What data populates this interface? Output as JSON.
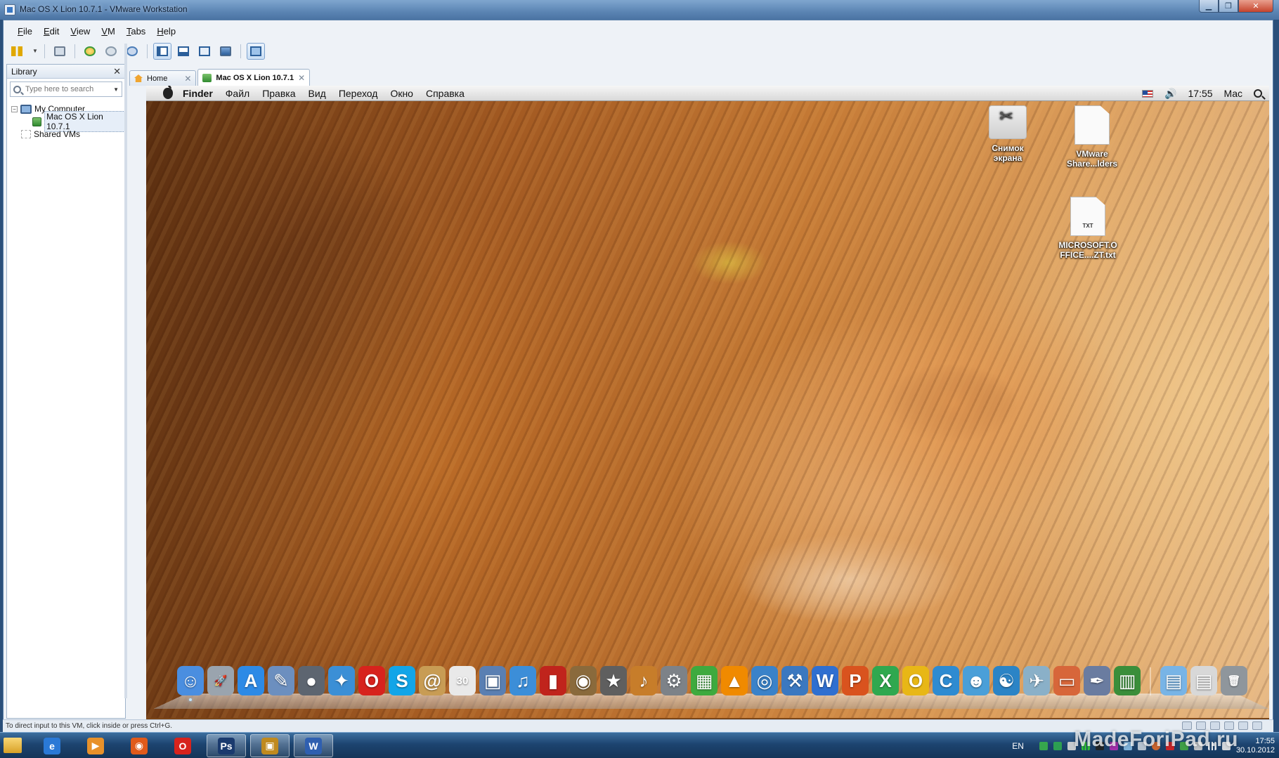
{
  "window": {
    "title": "Mac OS X Lion 10.7.1 - VMware Workstation",
    "controls": {
      "minimize": "▁",
      "maximize": "❐",
      "close": "✕"
    }
  },
  "menu": [
    "File",
    "Edit",
    "View",
    "VM",
    "Tabs",
    "Help"
  ],
  "library": {
    "title": "Library",
    "close": "✕",
    "search_placeholder": "Type here to search",
    "tree": {
      "my_computer": "My Computer",
      "vm": "Mac OS X Lion 10.7.1",
      "shared": "Shared VMs"
    }
  },
  "tabs": [
    {
      "label": "Home",
      "close": "✕"
    },
    {
      "label": "Mac OS X Lion 10.7.1",
      "close": "✕"
    }
  ],
  "mac": {
    "app": "Finder",
    "menus": [
      "Файл",
      "Правка",
      "Вид",
      "Переход",
      "Окно",
      "Справка"
    ],
    "time": "17:55",
    "user": "Mac",
    "speaker": "🔊"
  },
  "desktop_icons": [
    {
      "line1": "Снимок",
      "line2": "экрана"
    },
    {
      "line1": "VMware",
      "line2": "Share...lders"
    },
    {
      "line1": "MICROSOFT.O",
      "line2": "FFICE....ZT.txt",
      "tag": "TXT"
    }
  ],
  "dock": [
    {
      "name": "finder",
      "glyph": "☺",
      "color": "#4a8ee0"
    },
    {
      "name": "launchpad",
      "glyph": "🚀",
      "color": "#9aa4ae"
    },
    {
      "name": "app-store",
      "glyph": "A",
      "color": "#2d8ae6"
    },
    {
      "name": "preview",
      "glyph": "✎",
      "color": "#6c8fbf"
    },
    {
      "name": "facetime",
      "glyph": "●",
      "color": "#5d6570"
    },
    {
      "name": "safari",
      "glyph": "✦",
      "color": "#3b8fd6"
    },
    {
      "name": "opera",
      "glyph": "O",
      "color": "#d7231d"
    },
    {
      "name": "skype",
      "glyph": "S",
      "color": "#12a5e8"
    },
    {
      "name": "address-book",
      "glyph": "@",
      "color": "#c89c54"
    },
    {
      "name": "ical",
      "glyph": "30",
      "color": "#e9e9e9"
    },
    {
      "name": "iphoto",
      "glyph": "▣",
      "color": "#5a7fb2"
    },
    {
      "name": "itunes",
      "glyph": "♫",
      "color": "#3c8ed8"
    },
    {
      "name": "photo-booth",
      "glyph": "▮",
      "color": "#c0241c"
    },
    {
      "name": "image-capture",
      "glyph": "◉",
      "color": "#8a6a3c"
    },
    {
      "name": "imovie",
      "glyph": "★",
      "color": "#5f5f5f"
    },
    {
      "name": "garageband",
      "glyph": "♪",
      "color": "#c77d2a"
    },
    {
      "name": "system-preferences",
      "glyph": "⚙",
      "color": "#7d8288"
    },
    {
      "name": "numbers",
      "glyph": "▦",
      "color": "#3eaa3e"
    },
    {
      "name": "vlc",
      "glyph": "▲",
      "color": "#f08a00"
    },
    {
      "name": "spiral-app",
      "glyph": "◎",
      "color": "#3a82c9"
    },
    {
      "name": "xcode",
      "glyph": "⚒",
      "color": "#3b78c0"
    },
    {
      "name": "word",
      "glyph": "W",
      "color": "#2f6fd0"
    },
    {
      "name": "powerpoint",
      "glyph": "P",
      "color": "#d9531e"
    },
    {
      "name": "excel",
      "glyph": "X",
      "color": "#2fa84f"
    },
    {
      "name": "outlook",
      "glyph": "O",
      "color": "#e8b716"
    },
    {
      "name": "communicator",
      "glyph": "C",
      "color": "#2e8bd1"
    },
    {
      "name": "messenger",
      "glyph": "☻",
      "color": "#4a9fd8"
    },
    {
      "name": "network",
      "glyph": "☯",
      "color": "#2b84c6"
    },
    {
      "name": "image-app",
      "glyph": "✈",
      "color": "#8ab0c8"
    },
    {
      "name": "keynote",
      "glyph": "▭",
      "color": "#d7663a"
    },
    {
      "name": "utility",
      "glyph": "✒",
      "color": "#6a7ca0"
    },
    {
      "name": "activity-monitor",
      "glyph": "▥",
      "color": "#3a8e3a"
    },
    {
      "name": "documents-folder",
      "glyph": "▤",
      "color": "#78b4e6"
    },
    {
      "name": "downloads",
      "glyph": "▤",
      "color": "#d8d8d8"
    },
    {
      "name": "trash",
      "glyph": "🗑",
      "color": "#8f969c"
    }
  ],
  "statusbar": {
    "text": "To direct input to this VM, click inside or press Ctrl+G."
  },
  "taskbar": {
    "apps": [
      {
        "name": "internet-explorer",
        "glyph": "e",
        "color": "#2a79d6"
      },
      {
        "name": "media-player",
        "glyph": "▶",
        "color": "#e8912a"
      },
      {
        "name": "firefox",
        "glyph": "◉",
        "color": "#e05a1b"
      },
      {
        "name": "opera",
        "glyph": "O",
        "color": "#d7231d"
      },
      {
        "name": "photoshop",
        "glyph": "Ps",
        "color": "#1a3a6e"
      },
      {
        "name": "vmware",
        "glyph": "▣",
        "color": "#c08a1f"
      },
      {
        "name": "word",
        "glyph": "W",
        "color": "#2f5fb0"
      }
    ],
    "lang": "EN",
    "time": "17:55",
    "date": "30.10.2012",
    "watermark": "MadeForiPad.ru"
  }
}
